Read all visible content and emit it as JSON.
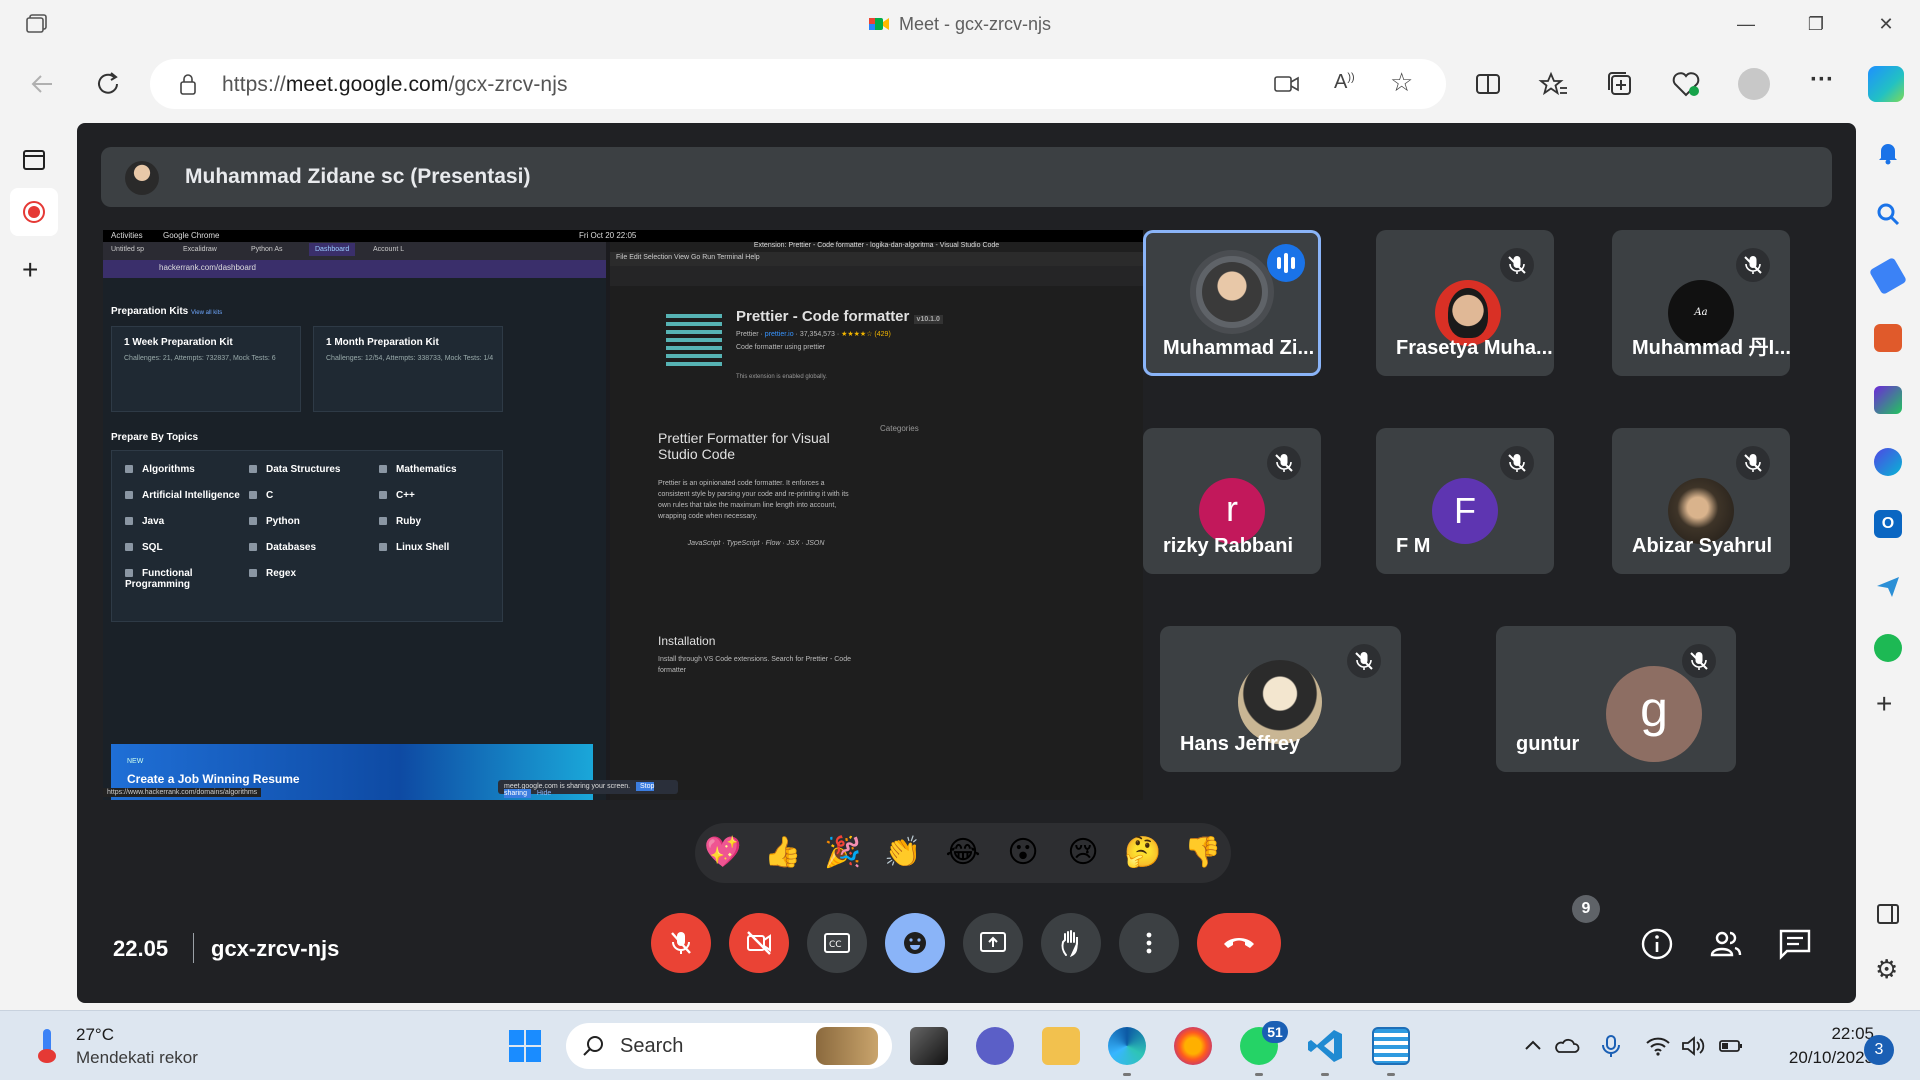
{
  "browser": {
    "window_title": "Meet - gcx-zrcv-njs",
    "url_prefix": "https://",
    "url_host": "meet.google.com",
    "url_path": "/gcx-zrcv-njs"
  },
  "meet": {
    "presenter_label": "Muhammad Zidane sc (Presentasi)",
    "meeting_time": "22.05",
    "meeting_code": "gcx-zrcv-njs",
    "participant_count_badge": "9",
    "participants": [
      {
        "name": "Muhammad Zi...",
        "avatar_letter": "",
        "avatar_color": "#cccccc",
        "speaking": true
      },
      {
        "name": "Frasetya Muha...",
        "avatar_letter": "",
        "avatar_color": "#d93025",
        "speaking": false
      },
      {
        "name": "Muhammad 丹I...",
        "avatar_letter": "",
        "avatar_color": "#111111",
        "speaking": false
      },
      {
        "name": "rizky Rabbani",
        "avatar_letter": "r",
        "avatar_color": "#c2185b",
        "speaking": false
      },
      {
        "name": "F M",
        "avatar_letter": "F",
        "avatar_color": "#5e35b1",
        "speaking": false
      },
      {
        "name": "Abizar Syahrul",
        "avatar_letter": "",
        "avatar_color": "#6b5a48",
        "speaking": false
      },
      {
        "name": "Hans Jeffrey",
        "avatar_letter": "",
        "avatar_color": "#d8c9a8",
        "speaking": false
      },
      {
        "name": "guntur",
        "avatar_letter": "g",
        "avatar_color": "#8d6e63",
        "speaking": false
      }
    ],
    "reactions": [
      "💖",
      "👍",
      "🎉",
      "👏",
      "😂",
      "😮",
      "😢",
      "🤔",
      "👎"
    ]
  },
  "shared_screen": {
    "os_bar_left": "Activities",
    "os_bar_app": "Google Chrome",
    "os_bar_clock": "Fri Oct 20 22:05",
    "chrome_tabs": [
      "Untitled sp",
      "Excalidraw",
      "Python As",
      "Dashboard",
      "Account L"
    ],
    "chrome_url": "hackerrank.com/dashboard",
    "prep_kits_title": "Preparation Kits",
    "prep_kits_link": "View all kits",
    "kit1_title": "1 Week Preparation Kit",
    "kit1_stats": "Challenges: 21, Attempts: 732837, Mock Tests: 6",
    "kit2_title": "1 Month Preparation Kit",
    "kit2_stats": "Challenges: 12/54, Attempts: 338733, Mock Tests: 1/4",
    "topics_title": "Prepare By Topics",
    "topics": [
      "Algorithms",
      "Data Structures",
      "Mathematics",
      "Artificial Intelligence",
      "C",
      "C++",
      "Java",
      "Python",
      "Ruby",
      "SQL",
      "Databases",
      "Linux Shell",
      "Functional Programming",
      "Regex"
    ],
    "banner_new": "NEW",
    "banner_title": "Create a Job Winning Resume",
    "status_url": "https://www.hackerrank.com/domains/algorithms",
    "vscode_title": "Extension: Prettier - Code formatter - logika-dan-algoritma - Visual Studio Code",
    "vscode_menu": "File  Edit  Selection  View  Go  Run  Terminal  Help",
    "ext_name": "Prettier - Code formatter",
    "ext_version": "v10.1.0",
    "ext_publisher": "Prettier",
    "ext_site": "prettier.io",
    "ext_installs": "37,354,573",
    "ext_rating": "★★★★☆ (429)",
    "ext_desc": "Code formatter using prettier",
    "ext_enabled": "This extension is enabled globally.",
    "readme_title": "Prettier Formatter for Visual Studio Code",
    "readme_body": "Prettier is an opinionated code formatter. It enforces a consistent style by parsing your code and re-printing it with its own rules that take the maximum line length into account, wrapping code when necessary.",
    "readme_langs": "JavaScript · TypeScript · Flow · JSX · JSON",
    "installation": "Installation",
    "install_text": "Install through VS Code extensions. Search for Prettier - Code formatter",
    "categories": "Categories",
    "share_notice": "meet.google.com is sharing your screen.",
    "stop_sharing": "Stop sharing",
    "hide": "Hide"
  },
  "taskbar": {
    "weather_temp": "27°C",
    "weather_desc": "Mendekati rekor",
    "search_placeholder": "Search",
    "whatsapp_badge": "51",
    "clock_time": "22:05",
    "clock_date": "20/10/2023",
    "notification_count": "3"
  },
  "colors": {
    "meet_bg": "#202124",
    "tile_bg": "#3c4043",
    "end_call_red": "#ea4335",
    "active_blue": "#8ab4f8"
  }
}
